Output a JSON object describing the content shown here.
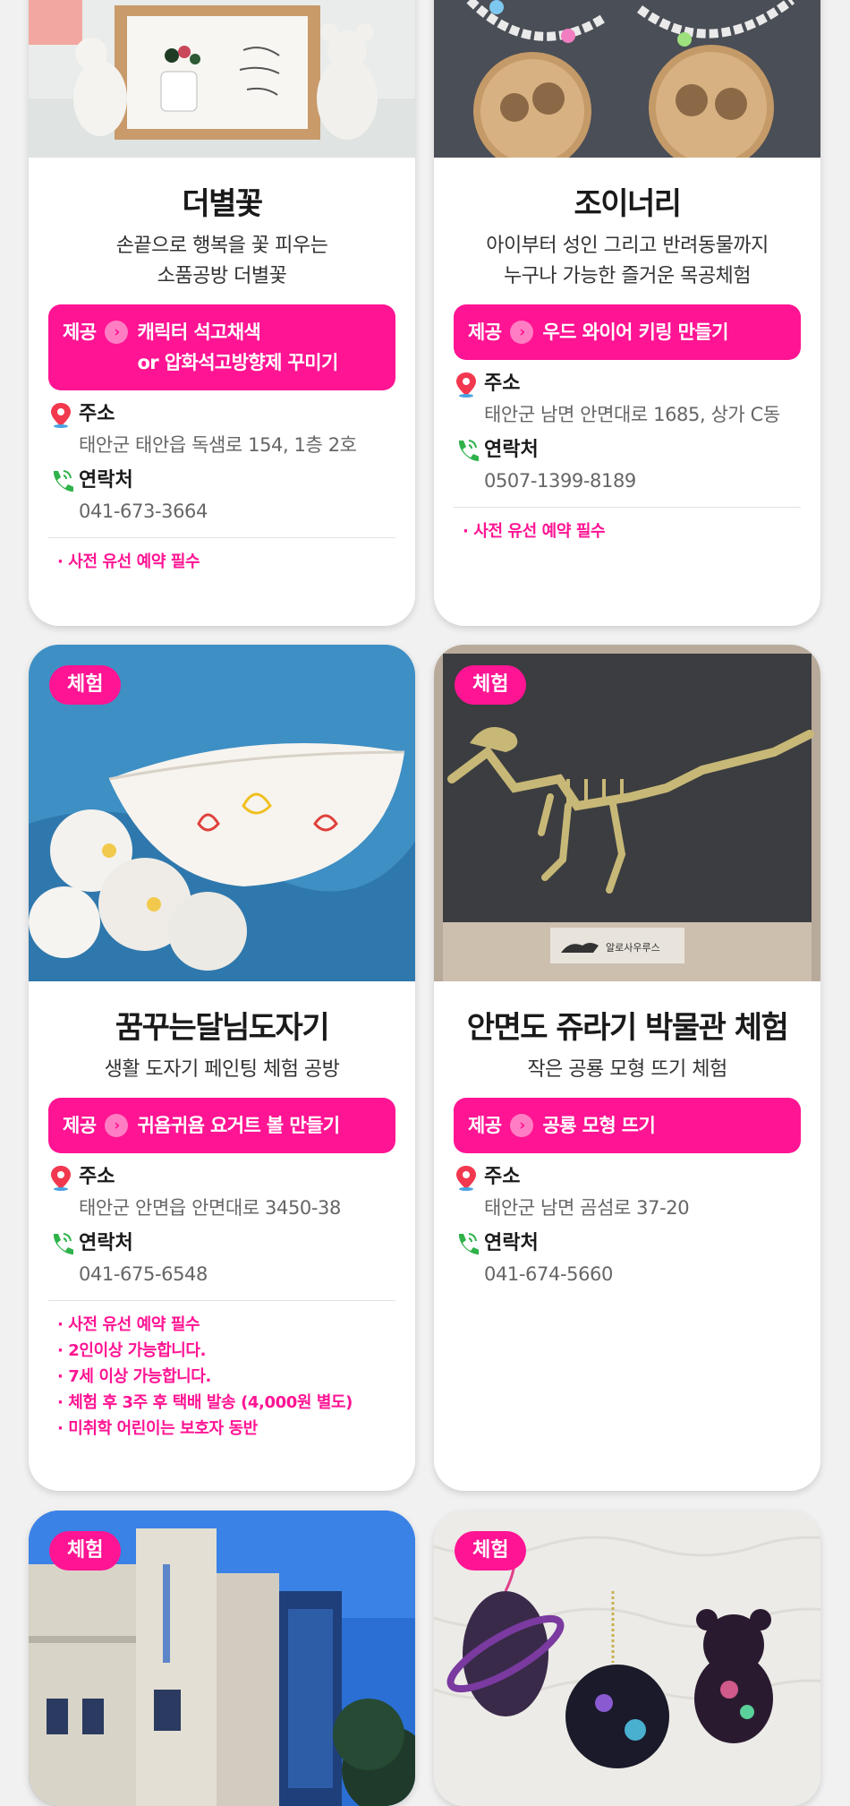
{
  "labels": {
    "badge": "체험",
    "offer_label": "제공",
    "address_label": "주소",
    "contact_label": "연락처"
  },
  "cards": [
    {
      "title": "더별꽃",
      "desc_lines": [
        "손끝으로 행복을 꽃 피우는",
        "소품공방 더별꽃"
      ],
      "offer": "캐릭터 석고채색\nor 압화석고방향제 꾸미기",
      "address": "태안군 태안읍 독샘로 154, 1층 2호",
      "phone": "041-673-3664",
      "notes": [
        "· 사전 유선 예약 필수"
      ]
    },
    {
      "title": "조이너리",
      "desc_lines": [
        "아이부터 성인 그리고 반려동물까지",
        "누구나 가능한 즐거운 목공체험"
      ],
      "offer": "우드 와이어 키링 만들기",
      "address": "태안군 남면 안면대로 1685, 상가 C동",
      "phone": "0507-1399-8189",
      "notes": [
        "· 사전 유선 예약 필수"
      ]
    },
    {
      "badge": "체험",
      "title": "꿈꾸는달님도자기",
      "desc_lines": [
        "생활 도자기 페인팅 체험 공방"
      ],
      "offer": "귀욤귀욤 요거트 볼 만들기",
      "address": "태안군 안면읍 안면대로 3450-38",
      "phone": "041-675-6548",
      "notes": [
        "· 사전 유선 예약 필수",
        "· 2인이상 가능합니다.",
        "· 7세 이상 가능합니다.",
        "· 체험 후 3주 후 택배 발송 (4,000원 별도)",
        "· 미취학 어린이는 보호자 동반"
      ]
    },
    {
      "badge": "체험",
      "title": "안면도 쥬라기 박물관 체험",
      "desc_lines": [
        "작은 공룡 모형 뜨기 체험"
      ],
      "offer": "공룡 모형 뜨기",
      "address": "태안군 남면 곰섬로 37-20",
      "phone": "041-674-5660",
      "plaque_text": "알로사우루스",
      "notes": []
    },
    {
      "badge": "체험"
    },
    {
      "badge": "체험"
    }
  ],
  "colors": {
    "accent": "#ff1493",
    "background": "#f1f1f1",
    "card": "#ffffff"
  },
  "icons": {
    "address": "map-pin-icon",
    "phone": "phone-icon",
    "chevron": "chevron-right-icon"
  }
}
